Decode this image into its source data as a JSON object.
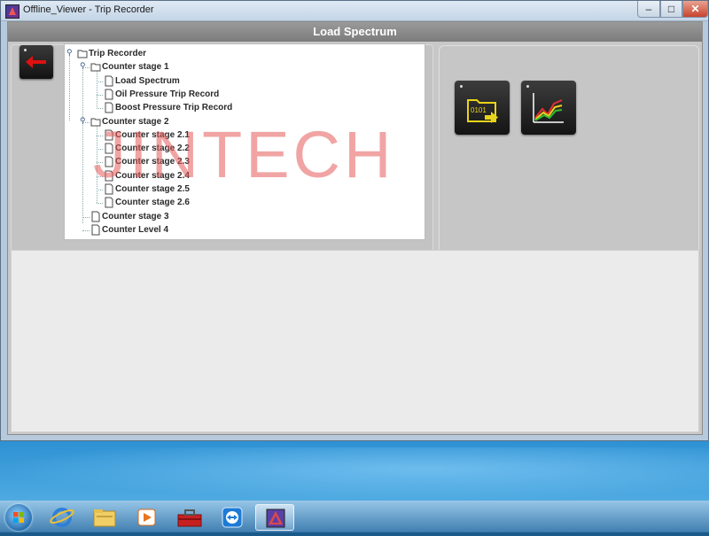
{
  "window": {
    "title": "Offline_Viewer - Trip Recorder",
    "controls": {
      "minimize": "–",
      "maximize": "□",
      "close": "✕"
    }
  },
  "header": {
    "title": "Load Spectrum"
  },
  "watermark": "JINTECH",
  "tree": {
    "root": "Trip Recorder",
    "nodes": [
      {
        "label": "Counter stage 1",
        "type": "folder",
        "expanded": true
      },
      {
        "label": "Load Spectrum",
        "type": "file"
      },
      {
        "label": "Oil Pressure Trip Record",
        "type": "file"
      },
      {
        "label": "Boost Pressure Trip Record",
        "type": "file"
      },
      {
        "label": "Counter stage 2",
        "type": "folder",
        "expanded": true
      },
      {
        "label": "Counter stage 2.1",
        "type": "file"
      },
      {
        "label": "Counter stage 2.2",
        "type": "file"
      },
      {
        "label": "Counter stage 2.3",
        "type": "file"
      },
      {
        "label": "Counter stage 2.4",
        "type": "file"
      },
      {
        "label": "Counter stage 2.5",
        "type": "file"
      },
      {
        "label": "Counter stage 2.6",
        "type": "file"
      },
      {
        "label": "Counter stage 3",
        "type": "file"
      },
      {
        "label": "Counter Level 4",
        "type": "file"
      }
    ]
  },
  "tools": [
    {
      "icon": "open-binary-file-icon",
      "code": "0101"
    },
    {
      "icon": "line-chart-icon"
    }
  ],
  "colors": {
    "header_bg": "#8a8a8a",
    "back_arrow": "#e01010",
    "folder_icon_accent": "#e8d41a",
    "chart_red": "#e53030",
    "chart_yellow": "#f0d020",
    "chart_green": "#30c030"
  },
  "taskbar": {
    "apps": [
      "internet-explorer-icon",
      "file-explorer-icon",
      "media-player-icon",
      "toolbox-icon",
      "teamviewer-icon",
      "offline-viewer-icon"
    ]
  }
}
